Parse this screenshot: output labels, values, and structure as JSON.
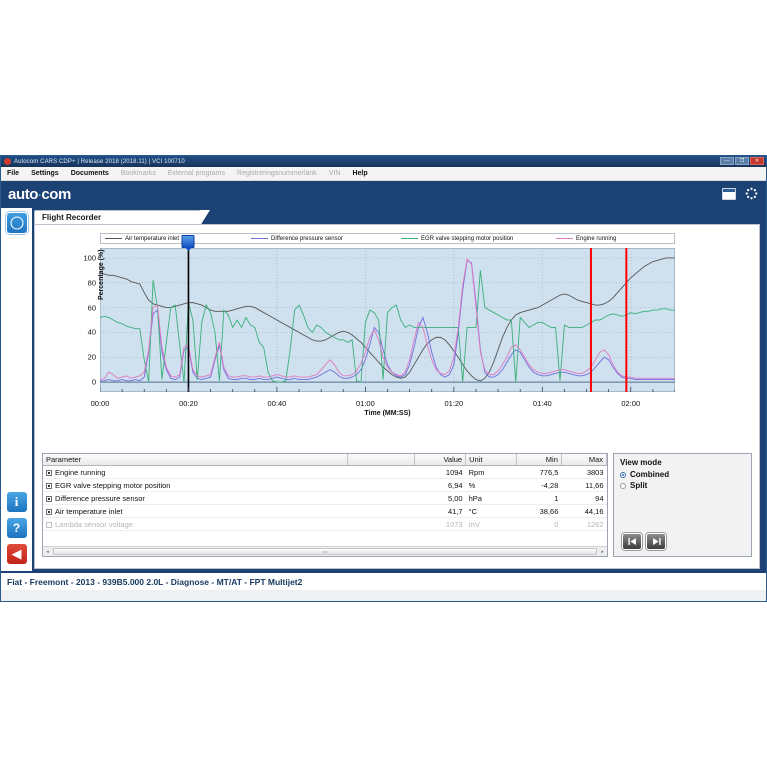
{
  "window": {
    "title": "Autocom CARS CDP+  |  Release 2018 (2018.11)  |  VCI 100710",
    "buttons": {
      "minimize": "—",
      "maximize": "❐",
      "close": "✕"
    }
  },
  "menubar": {
    "items": [
      {
        "label": "File",
        "enabled": true
      },
      {
        "label": "Settings",
        "enabled": true
      },
      {
        "label": "Documents",
        "enabled": true
      },
      {
        "label": "Bookmarks",
        "enabled": false
      },
      {
        "label": "External programs",
        "enabled": false
      },
      {
        "label": "Registreringsnummerlänk",
        "enabled": false
      },
      {
        "label": "VIN",
        "enabled": false
      },
      {
        "label": "Help",
        "enabled": true
      }
    ]
  },
  "brand": {
    "name_left": "auto",
    "name_dot": "·",
    "name_right": "com",
    "icons": [
      "note-icon",
      "gear-icon"
    ]
  },
  "sidebar": {
    "items": [
      {
        "name": "gauge-icon",
        "glyph": ""
      },
      {
        "name": "info-icon",
        "glyph": "i"
      },
      {
        "name": "help-icon",
        "glyph": "?"
      },
      {
        "name": "back-icon",
        "glyph": "◀"
      }
    ]
  },
  "tab": {
    "label": "Flight Recorder"
  },
  "chart_data": {
    "type": "line",
    "title": "",
    "xlabel": "Time (MM:SS)",
    "ylabel": "Percentage (%)",
    "xlim": [
      0,
      130
    ],
    "ylim": [
      -8,
      108
    ],
    "xticks": [
      "00:00",
      "00:20",
      "00:40",
      "01:00",
      "01:20",
      "01:40",
      "02:00"
    ],
    "xtick_values": [
      0,
      20,
      40,
      60,
      80,
      100,
      120
    ],
    "yticks": [
      0,
      20,
      40,
      60,
      80,
      100
    ],
    "grid": true,
    "grid_style": "dotted",
    "plot_bg": "#cfe0ef",
    "legend_position": "top",
    "cursor": {
      "name": "time-cursor",
      "time": 20,
      "color": "#000000",
      "handle_color": "#1551c4"
    },
    "markers": [
      {
        "name": "region-start-marker",
        "time": 111,
        "color": "#ff0000"
      },
      {
        "name": "region-end-marker",
        "time": 119,
        "color": "#ff0000"
      }
    ],
    "series": [
      {
        "name": "Air temperature inlet",
        "color": "#555555",
        "values": [
          88,
          87,
          86,
          86,
          85,
          84,
          83,
          81,
          80,
          79,
          72,
          66,
          63,
          62,
          61,
          60,
          60,
          61,
          62,
          63,
          64,
          64,
          63,
          62,
          60,
          58,
          57,
          57,
          57,
          57,
          58,
          59,
          60,
          61,
          61,
          60,
          58,
          56,
          54,
          52,
          50,
          48,
          46,
          44,
          42,
          40,
          38,
          36,
          34,
          33,
          33,
          34,
          36,
          38,
          40,
          41,
          40,
          38,
          35,
          32,
          28,
          24,
          20,
          16,
          12,
          9,
          6,
          4,
          3,
          4,
          8,
          14,
          20,
          26,
          31,
          34,
          36,
          36,
          34,
          30,
          25,
          20,
          14,
          9,
          5,
          2,
          1,
          3,
          8,
          16,
          26,
          36,
          44,
          50,
          54,
          56,
          57,
          58,
          59,
          60,
          62,
          64,
          66,
          68,
          70,
          71,
          70,
          68,
          66,
          65,
          64,
          63,
          62,
          62,
          63,
          65,
          68,
          72,
          76,
          80,
          84,
          87,
          90,
          93,
          95,
          97,
          98,
          99,
          100,
          100,
          100
        ]
      },
      {
        "name": "Difference pressure sensor",
        "color": "#6f6fe0",
        "values": [
          1,
          1,
          2,
          1,
          1,
          2,
          1,
          1,
          2,
          1,
          4,
          24,
          55,
          58,
          24,
          10,
          3,
          2,
          4,
          26,
          28,
          8,
          3,
          2,
          3,
          4,
          18,
          30,
          10,
          3,
          2,
          2,
          3,
          3,
          2,
          2,
          3,
          2,
          2,
          3,
          4,
          3,
          2,
          2,
          3,
          2,
          2,
          2,
          3,
          4,
          6,
          8,
          10,
          8,
          5,
          3,
          3,
          4,
          6,
          10,
          18,
          30,
          44,
          40,
          26,
          14,
          8,
          5,
          4,
          6,
          14,
          28,
          44,
          52,
          40,
          24,
          12,
          6,
          4,
          6,
          14,
          40,
          74,
          98,
          96,
          64,
          26,
          8,
          4,
          4,
          6,
          10,
          16,
          22,
          26,
          24,
          18,
          12,
          8,
          6,
          5,
          5,
          6,
          7,
          8,
          8,
          7,
          6,
          5,
          5,
          6,
          8,
          12,
          16,
          20,
          18,
          12,
          7,
          4,
          3,
          3,
          2,
          2,
          2,
          2,
          2,
          2,
          2,
          2,
          2,
          2
        ]
      },
      {
        "name": "EGR valve stepping motor position",
        "color": "#3bb07a",
        "values": [
          52,
          53,
          52,
          50,
          48,
          47,
          45,
          44,
          43,
          43,
          18,
          0,
          82,
          60,
          2,
          32,
          60,
          62,
          30,
          0,
          64,
          50,
          2,
          48,
          62,
          56,
          40,
          1,
          58,
          54,
          44,
          50,
          44,
          52,
          46,
          44,
          32,
          28,
          8,
          1,
          0,
          0,
          1,
          26,
          58,
          62,
          54,
          44,
          40,
          46,
          44,
          40,
          38,
          36,
          34,
          34,
          32,
          34,
          1,
          0,
          48,
          58,
          56,
          50,
          2,
          56,
          60,
          62,
          50,
          44,
          46,
          44,
          44,
          44,
          44,
          44,
          44,
          44,
          44,
          44,
          44,
          44,
          0,
          44,
          44,
          44,
          90,
          60,
          58,
          56,
          54,
          52,
          50,
          50,
          0,
          52,
          48,
          44,
          46,
          48,
          48,
          46,
          44,
          44,
          1,
          46,
          44,
          44,
          44,
          44,
          46,
          48,
          50,
          50,
          52,
          54,
          55,
          54,
          53,
          54,
          56,
          55,
          56,
          57,
          57,
          58,
          58,
          59,
          59,
          58,
          58
        ]
      },
      {
        "name": "Engine running",
        "color": "#e07ac0",
        "values": [
          2,
          3,
          8,
          6,
          3,
          4,
          5,
          3,
          4,
          5,
          8,
          26,
          60,
          62,
          28,
          12,
          5,
          4,
          6,
          28,
          30,
          10,
          5,
          4,
          5,
          6,
          20,
          32,
          12,
          5,
          4,
          4,
          5,
          5,
          4,
          4,
          5,
          4,
          4,
          5,
          6,
          5,
          4,
          4,
          5,
          4,
          4,
          4,
          5,
          6,
          10,
          14,
          18,
          14,
          8,
          5,
          5,
          6,
          9,
          15,
          24,
          36,
          42,
          34,
          20,
          12,
          8,
          6,
          5,
          8,
          18,
          34,
          48,
          44,
          30,
          18,
          10,
          7,
          6,
          9,
          20,
          44,
          78,
          99,
          95,
          60,
          24,
          10,
          6,
          6,
          9,
          14,
          20,
          28,
          30,
          26,
          20,
          14,
          10,
          8,
          7,
          7,
          8,
          9,
          10,
          10,
          9,
          8,
          7,
          7,
          9,
          12,
          18,
          24,
          26,
          22,
          14,
          8,
          5,
          4,
          4,
          3,
          3,
          3,
          3,
          3,
          3,
          3,
          3,
          3,
          3
        ]
      }
    ]
  },
  "table": {
    "headers": [
      "Parameter",
      "",
      "Value",
      "Unit",
      "Min",
      "Max"
    ],
    "rows": [
      {
        "checked": true,
        "enabled": true,
        "parameter": "Engine running",
        "value": "1094",
        "unit": "Rpm",
        "min": "776,5",
        "max": "3803"
      },
      {
        "checked": true,
        "enabled": true,
        "parameter": "EGR valve stepping motor position",
        "value": "6,94",
        "unit": "%",
        "min": "-4,28",
        "max": "11,66"
      },
      {
        "checked": true,
        "enabled": true,
        "parameter": "Difference pressure sensor",
        "value": "5,00",
        "unit": "hPa",
        "min": "1",
        "max": "94"
      },
      {
        "checked": true,
        "enabled": true,
        "parameter": "Air temperature inlet",
        "value": "41,7",
        "unit": "°C",
        "min": "38,66",
        "max": "44,16"
      },
      {
        "checked": false,
        "enabled": false,
        "parameter": "Lambda sensor voltage",
        "value": "1073",
        "unit": "mV",
        "min": "0",
        "max": "1262"
      }
    ],
    "scrollbar": {
      "left_arrow": "◂",
      "right_arrow": "▸"
    }
  },
  "view_mode": {
    "title": "View mode",
    "options": [
      {
        "label": "Combined",
        "selected": true
      },
      {
        "label": "Split",
        "selected": false
      }
    ],
    "nav": [
      {
        "name": "jump-to-start-button",
        "glyph": "◀❙"
      },
      {
        "name": "jump-to-end-button",
        "glyph": "❙▶"
      }
    ]
  },
  "statusbar": {
    "text": "Fiat - Freemont - 2013 - 939B5.000 2.0L - Diagnose - MT/AT - FPT Multijet2"
  }
}
